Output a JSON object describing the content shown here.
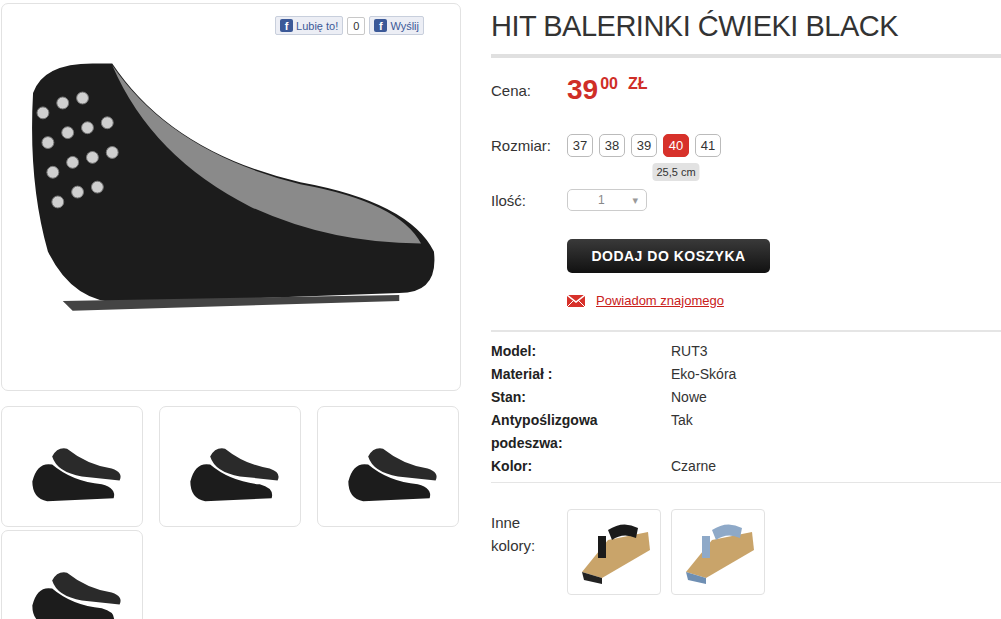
{
  "social": {
    "fb_icon": "f",
    "like": "Lubię to!",
    "count": "0",
    "send": "Wyślij"
  },
  "product": {
    "title": "HIT BALERINKI ĆWIEKI BLACK",
    "price_label": "Cena:",
    "price_main": "39",
    "price_cents": "00",
    "currency": "ZŁ"
  },
  "sizes": {
    "label": "Rozmiar:",
    "options": [
      {
        "label": "37",
        "selected": false
      },
      {
        "label": "38",
        "selected": false
      },
      {
        "label": "39",
        "selected": false
      },
      {
        "label": "40",
        "selected": true
      },
      {
        "label": "41",
        "selected": false
      }
    ],
    "tooltip": "25,5 cm"
  },
  "quantity": {
    "label": "Ilość:",
    "value": "1",
    "arrow": "▾"
  },
  "add_to_cart": "DODAJ DO KOSZYKA",
  "notify": "Powiadom znajomego",
  "specs": [
    {
      "label": "Model:",
      "value": "RUT3"
    },
    {
      "label": "Materiał :",
      "value": "Eko-Skóra"
    },
    {
      "label": "Stan:",
      "value": "Nowe"
    },
    {
      "label": "Antypoślizgowa podeszwa:",
      "value": "Tak"
    },
    {
      "label": "Kolor:",
      "value": "Czarne"
    }
  ],
  "other_colors": {
    "label": "Inne kolory:"
  }
}
